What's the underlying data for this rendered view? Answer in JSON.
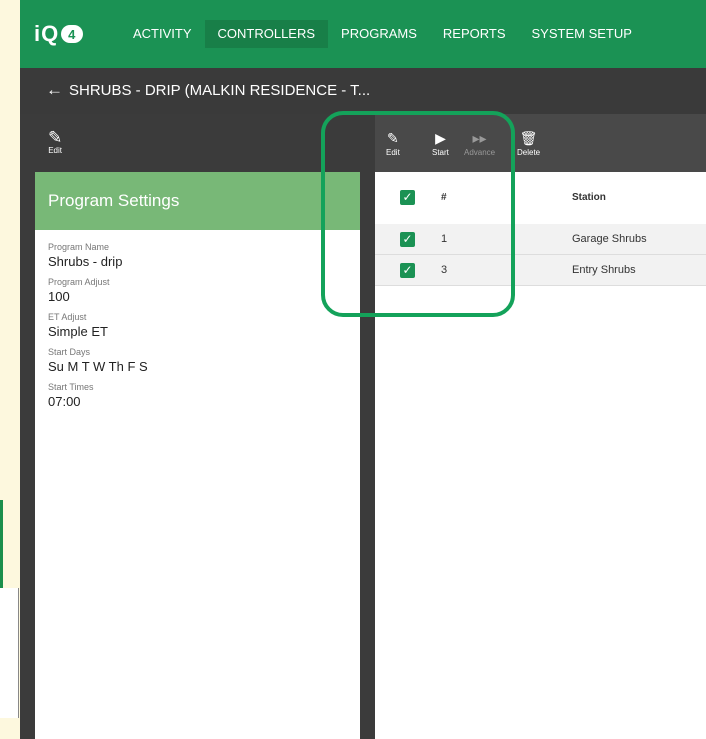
{
  "app": {
    "logo_text": "iQ",
    "logo_badge": "4"
  },
  "nav": {
    "items": [
      {
        "label": "ACTIVITY"
      },
      {
        "label": "CONTROLLERS"
      },
      {
        "label": "PROGRAMS"
      },
      {
        "label": "REPORTS"
      },
      {
        "label": "SYSTEM SETUP"
      }
    ],
    "active": "CONTROLLERS"
  },
  "titlebar": {
    "back_icon": "arrow-left-icon",
    "title": "SHRUBS - DRIP (MALKIN RESIDENCE - T..."
  },
  "left_toolbar": {
    "edit_label": "Edit"
  },
  "program_settings": {
    "header": "Program Settings",
    "fields": [
      {
        "label": "Program Name",
        "value": "Shrubs - drip"
      },
      {
        "label": "Program Adjust",
        "value": "100"
      },
      {
        "label": "ET Adjust",
        "value": "Simple ET"
      },
      {
        "label": "Start Days",
        "value": "Su M T W Th F S"
      },
      {
        "label": "Start Times",
        "value": "07:00"
      }
    ]
  },
  "station_toolbar": {
    "edit": "Edit",
    "start": "Start",
    "advance": "Advance",
    "delete": "Delete"
  },
  "station_table": {
    "headers": {
      "num": "#",
      "station": "Station"
    },
    "rows": [
      {
        "num": "1",
        "station": "Garage Shrubs",
        "checked": true
      },
      {
        "num": "3",
        "station": "Entry Shrubs",
        "checked": true
      }
    ]
  },
  "colors": {
    "brand_green": "#1b9254",
    "header_green": "#78b877",
    "annotation_green": "#14a25a",
    "dark_bg": "#3b3b3b"
  }
}
